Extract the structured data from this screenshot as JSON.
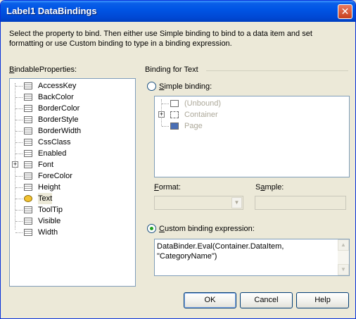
{
  "window": {
    "title": "Label1 DataBindings",
    "close_glyph": "✕"
  },
  "instruction": "Select the property to bind. Then either use Simple binding to bind to a data item and set formatting or use Custom binding to type in a binding expression.",
  "bindable": {
    "label_first": "B",
    "label_rest": "indableProperties:",
    "items": [
      {
        "label": "AccessKey",
        "expandable": false,
        "bound": false
      },
      {
        "label": "BackColor",
        "expandable": false,
        "bound": false
      },
      {
        "label": "BorderColor",
        "expandable": false,
        "bound": false
      },
      {
        "label": "BorderStyle",
        "expandable": false,
        "bound": false
      },
      {
        "label": "BorderWidth",
        "expandable": false,
        "bound": false
      },
      {
        "label": "CssClass",
        "expandable": false,
        "bound": false
      },
      {
        "label": "Enabled",
        "expandable": false,
        "bound": false
      },
      {
        "label": "Font",
        "expandable": true,
        "bound": false
      },
      {
        "label": "ForeColor",
        "expandable": false,
        "bound": false
      },
      {
        "label": "Height",
        "expandable": false,
        "bound": false
      },
      {
        "label": "Text",
        "expandable": false,
        "bound": true
      },
      {
        "label": "ToolTip",
        "expandable": false,
        "bound": false
      },
      {
        "label": "Visible",
        "expandable": false,
        "bound": false
      },
      {
        "label": "Width",
        "expandable": false,
        "bound": false
      }
    ]
  },
  "binding": {
    "group_label": "Binding for Text",
    "simple_first": "S",
    "simple_rest": "imple binding:",
    "simple_tree": [
      {
        "label": "(Unbound)"
      },
      {
        "label": "Container"
      },
      {
        "label": "Page"
      }
    ],
    "format_first": "F",
    "format_rest": "ormat:",
    "sample_prefix": "S",
    "sample_underlined": "a",
    "sample_rest": "mple:",
    "custom_first": "C",
    "custom_rest": "ustom binding expression:",
    "expression": "DataBinder.Eval(Container.DataItem, \"CategoryName\")"
  },
  "buttons": {
    "ok": "OK",
    "cancel": "Cancel",
    "help": "Help"
  }
}
